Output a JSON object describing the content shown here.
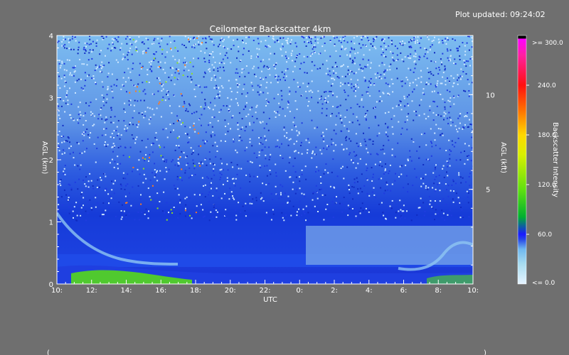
{
  "header": {
    "updated_text": "Plot updated: 09:24:02"
  },
  "chart_data": {
    "type": "heatmap",
    "title": "Ceilometer Backscatter 4km",
    "xlabel": "UTC",
    "ylabel": "AGL (km)",
    "y2label": "AGL (kft)",
    "x_ticks": [
      "10:",
      "12:",
      "14:",
      "16:",
      "18:",
      "20:",
      "22:",
      "0:",
      "2:",
      "4:",
      "6:",
      "8:",
      "10:"
    ],
    "ylim": [
      0,
      4
    ],
    "y_ticks": [
      "0",
      "1",
      "2",
      "3",
      "4"
    ],
    "y2_ticks": [
      "5",
      "10"
    ],
    "colorbar": {
      "label": "Backscatter Intensity",
      "min": 0,
      "max": 300,
      "min_label": "<=   0.0",
      "max_label": ">=  300.0",
      "tick_values": [
        60,
        120,
        180,
        240
      ],
      "tick_labels": [
        "60.0",
        "120.0",
        "180.0",
        "240.0"
      ],
      "colors": [
        "#e6f3ff",
        "#a8dcf0",
        "#6fb8f0",
        "#2646e8",
        "#1a1aff",
        "#00b030",
        "#60e010",
        "#d8f000",
        "#ffd800",
        "#ff7000",
        "#ff1010",
        "#ff20a0",
        "#ff00ff",
        "#000000"
      ]
    }
  },
  "footer": {
    "left_marker": "(",
    "right_marker": ")"
  }
}
